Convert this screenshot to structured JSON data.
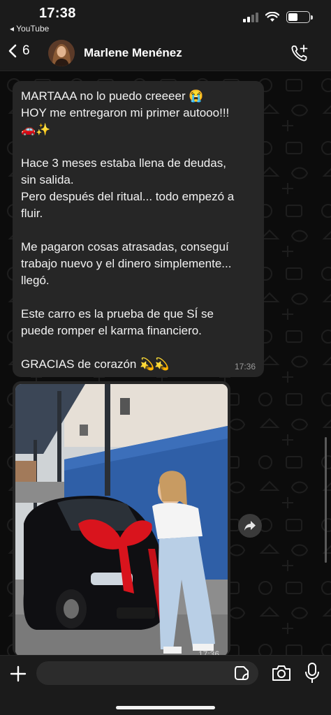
{
  "status_bar": {
    "time": "17:38",
    "back_app": "◂ YouTube"
  },
  "header": {
    "back_count": "6",
    "contact_name": "Marlene Menénez"
  },
  "messages": {
    "text_lines": [
      "MARTAAA no lo puedo creeeer 😭",
      "HOY me entregaron mi primer autooo!!!",
      "🚗✨",
      "",
      "Hace 3 meses estaba llena de deudas,",
      "sin salida.",
      "Pero después del ritual... todo empezó a",
      "fluir.",
      "",
      "Me pagaron cosas atrasadas, conseguí",
      "trabajo nuevo y el dinero simplemente...",
      "llegó.",
      "",
      "Este carro es la prueba de que SÍ se",
      "puede romper el karma financiero.",
      "",
      "GRACIAS de corazón 💫💫"
    ],
    "text_time": "17:36",
    "photo_time": "17:36"
  },
  "input": {
    "value": "",
    "placeholder": ""
  },
  "icons": {
    "back": "chevron-left-icon",
    "call": "add-call-icon",
    "plus": "plus-icon",
    "sticker": "sticker-icon",
    "camera": "camera-icon",
    "mic": "microphone-icon",
    "forward": "forward-icon"
  },
  "colors": {
    "background": "#0c0c0c",
    "bubble": "#262626",
    "header": "#1b1b1b",
    "bow": "#d9141d"
  }
}
